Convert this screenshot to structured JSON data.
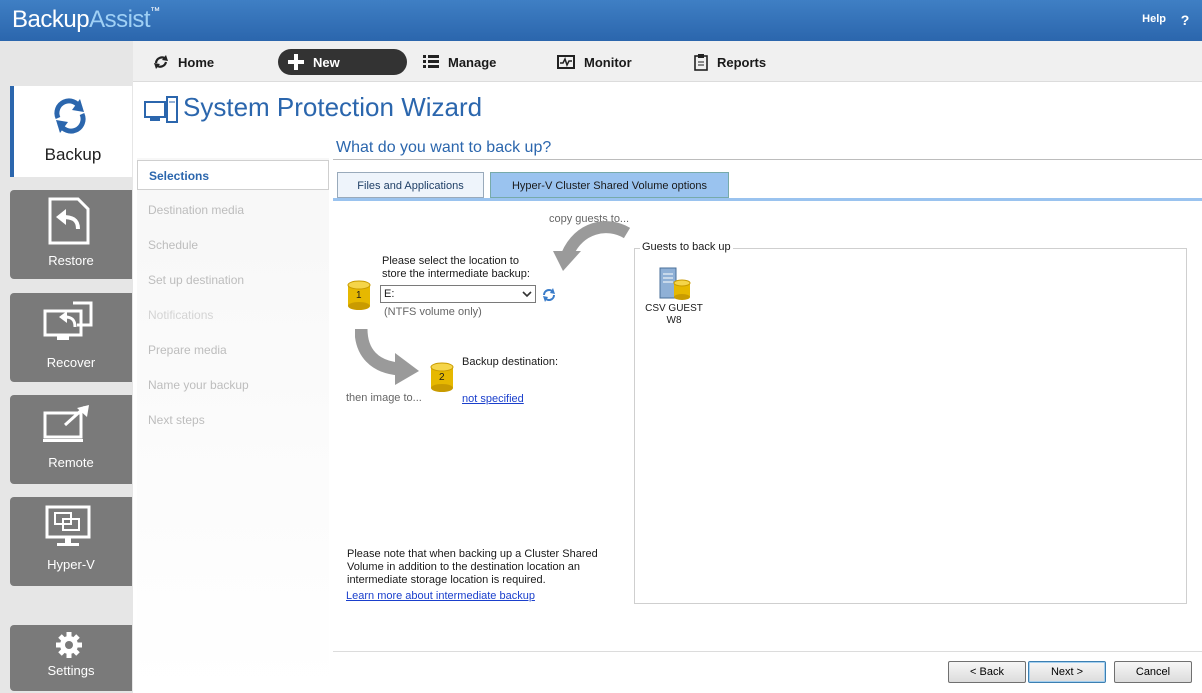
{
  "app": {
    "brand_a": "Backup",
    "brand_b": "Assist",
    "brand_tm": "™",
    "help_label": "Help",
    "help_icon": "?"
  },
  "sidebar": {
    "items": [
      {
        "label": "Backup",
        "icon": "backup-icon",
        "active": true
      },
      {
        "label": "Restore",
        "icon": "restore-icon"
      },
      {
        "label": "Recover",
        "icon": "recover-icon"
      },
      {
        "label": "Remote",
        "icon": "remote-icon"
      },
      {
        "label": "Hyper-V",
        "icon": "hyperv-icon"
      },
      {
        "label": "Settings",
        "icon": "gear-icon"
      }
    ]
  },
  "menu": {
    "items": [
      {
        "label": "Home",
        "icon": "home-icon"
      },
      {
        "label": "New",
        "icon": "plus-icon"
      },
      {
        "label": "Manage",
        "icon": "list-icon"
      },
      {
        "label": "Monitor",
        "icon": "monitor-icon"
      },
      {
        "label": "Reports",
        "icon": "report-icon"
      }
    ]
  },
  "wizard": {
    "title": "System Protection Wizard",
    "steps": [
      "Selections",
      "Destination media",
      "Schedule",
      "Set up destination",
      "Notifications",
      "Prepare media",
      "Name your backup",
      "Next steps"
    ],
    "active_step": 0,
    "question": "What do you want to back up?",
    "tabs": [
      "Files and Applications",
      "Hyper-V Cluster Shared Volume options"
    ],
    "active_tab": 1
  },
  "csv": {
    "copy_hint": "copy guests to...",
    "intermediate_prompt_1": "Please select the location to",
    "intermediate_prompt_2": "store the intermediate backup:",
    "step1_badge": "1",
    "drive_value": "E:",
    "ntfs_note": "(NTFS volume only)",
    "step2_badge": "2",
    "dest_label": "Backup destination:",
    "image_hint": "then image to...",
    "dest_value": "not specified",
    "note_1": "Please note that when backing up a Cluster Shared",
    "note_2": "Volume in addition to the destination location an",
    "note_3": "intermediate storage location is required.",
    "learn_more": "Learn more about intermediate backup",
    "guests_legend": "Guests to back up",
    "guests": [
      {
        "name_1": "CSV GUEST",
        "name_2": "W8"
      }
    ]
  },
  "buttons": {
    "back": "< Back",
    "next": "Next >",
    "cancel": "Cancel"
  }
}
